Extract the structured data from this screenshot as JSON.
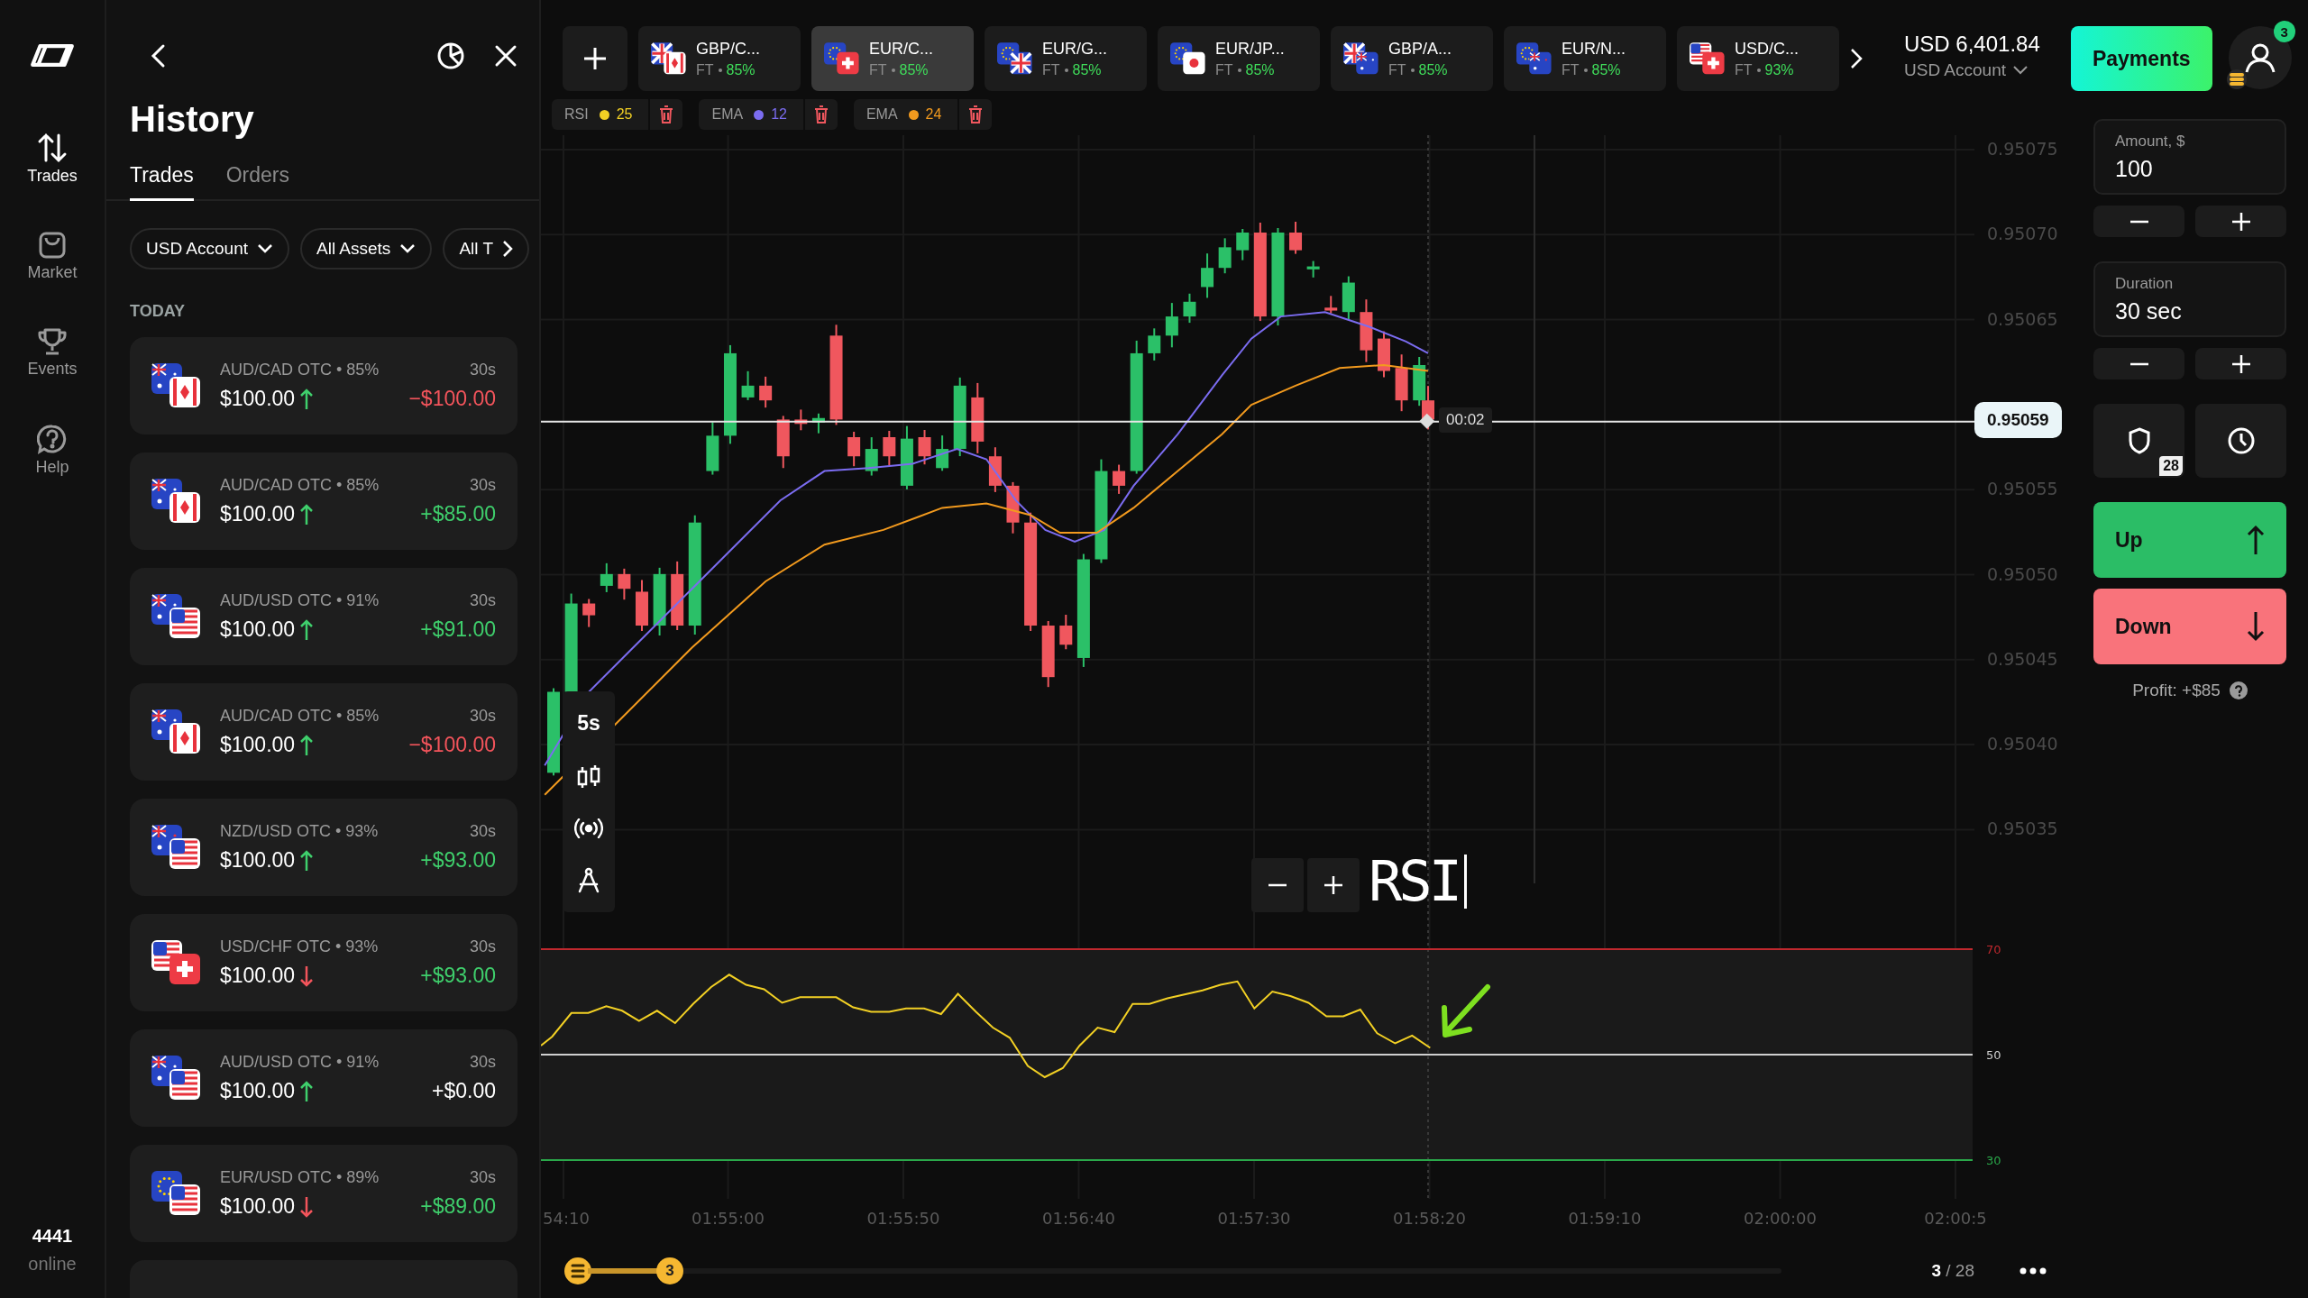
{
  "rail": {
    "items": [
      {
        "label": "Trades",
        "selected": true
      },
      {
        "label": "Market",
        "selected": false
      },
      {
        "label": "Events",
        "selected": false
      },
      {
        "label": "Help",
        "selected": false
      }
    ],
    "online_count": "4441",
    "online_label": "online"
  },
  "history": {
    "title": "History",
    "tabs": [
      {
        "label": "Trades",
        "selected": true
      },
      {
        "label": "Orders",
        "selected": false
      }
    ],
    "filters": [
      "USD Account",
      "All Assets",
      "All T"
    ],
    "section": "TODAY",
    "trades": [
      {
        "asset": "AUD/CAD OTC • 85%",
        "duration": "30s",
        "amount": "$100.00",
        "up": true,
        "result": "−$100.00",
        "kind": "loss"
      },
      {
        "asset": "AUD/CAD OTC • 85%",
        "duration": "30s",
        "amount": "$100.00",
        "up": true,
        "result": "+$85.00",
        "kind": "win"
      },
      {
        "asset": "AUD/USD OTC • 91%",
        "duration": "30s",
        "amount": "$100.00",
        "up": true,
        "result": "+$91.00",
        "kind": "win"
      },
      {
        "asset": "AUD/CAD OTC • 85%",
        "duration": "30s",
        "amount": "$100.00",
        "up": true,
        "result": "−$100.00",
        "kind": "loss"
      },
      {
        "asset": "NZD/USD OTC • 93%",
        "duration": "30s",
        "amount": "$100.00",
        "up": true,
        "result": "+$93.00",
        "kind": "win"
      },
      {
        "asset": "USD/CHF OTC • 93%",
        "duration": "30s",
        "amount": "$100.00",
        "up": false,
        "result": "+$93.00",
        "kind": "win"
      },
      {
        "asset": "AUD/USD OTC • 91%",
        "duration": "30s",
        "amount": "$100.00",
        "up": true,
        "result": "+$0.00",
        "kind": "draw"
      },
      {
        "asset": "EUR/USD OTC • 89%",
        "duration": "30s",
        "amount": "$100.00",
        "up": false,
        "result": "+$89.00",
        "kind": "win"
      }
    ]
  },
  "asset_tabs": [
    {
      "label": "GBP/C...",
      "market": "FT",
      "payout": "85%",
      "selected": false
    },
    {
      "label": "EUR/C...",
      "market": "FT",
      "payout": "85%",
      "selected": true
    },
    {
      "label": "EUR/G...",
      "market": "FT",
      "payout": "85%",
      "selected": false
    },
    {
      "label": "EUR/JP...",
      "market": "FT",
      "payout": "85%",
      "selected": false
    },
    {
      "label": "GBP/A...",
      "market": "FT",
      "payout": "85%",
      "selected": false
    },
    {
      "label": "EUR/N...",
      "market": "FT",
      "payout": "85%",
      "selected": false
    },
    {
      "label": "USD/C...",
      "market": "FT",
      "payout": "93%",
      "selected": false
    }
  ],
  "indicators": [
    {
      "name": "RSI",
      "period": "25",
      "color": "#f2d024"
    },
    {
      "name": "EMA",
      "period": "12",
      "color": "#7b6cf0"
    },
    {
      "name": "EMA",
      "period": "24",
      "color": "#f29a1e"
    }
  ],
  "account": {
    "balance": "USD 6,401.84",
    "name": "USD Account"
  },
  "payments_label": "Payments",
  "notifications": "3",
  "chart": {
    "price_ticks": [
      "0.95075",
      "0.95070",
      "0.95065",
      "0.95055",
      "0.95050",
      "0.95045",
      "0.95040",
      "0.95035"
    ],
    "current_price": "0.95059",
    "timer": "00:02",
    "timeframe": "5s",
    "caption": "RSI",
    "rsi_levels": [
      "70",
      "50",
      "30"
    ],
    "time_ticks": [
      "54:10",
      "01:55:00",
      "01:55:50",
      "01:56:40",
      "01:57:30",
      "01:58:20",
      "01:59:10",
      "02:00:00",
      "02:00:5"
    ]
  },
  "trade_panel": {
    "amount": {
      "label": "Amount, $",
      "value": "100"
    },
    "duration": {
      "label": "Duration",
      "value": "30 sec"
    },
    "pending_count": "28",
    "up_label": "Up",
    "down_label": "Down",
    "profit": "Profit: +$85"
  },
  "bottom": {
    "level_badge": "3",
    "page": "**3** / 28"
  }
}
